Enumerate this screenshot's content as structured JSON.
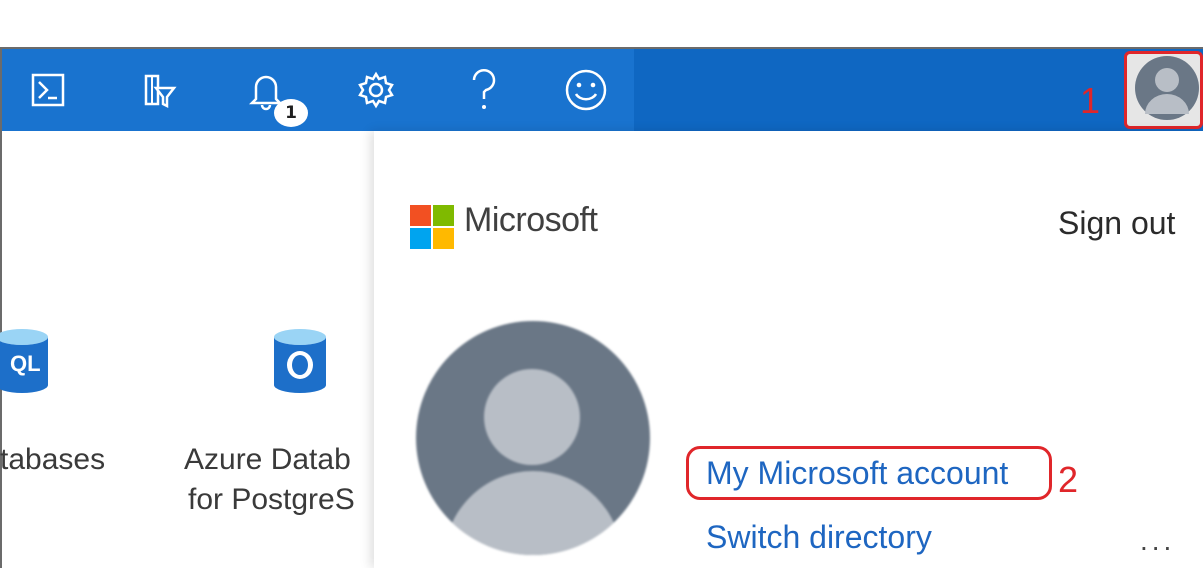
{
  "topbar": {
    "icons": [
      {
        "name": "cloud-shell-icon"
      },
      {
        "name": "directory-filter-icon"
      },
      {
        "name": "notifications-icon"
      },
      {
        "name": "settings-icon"
      },
      {
        "name": "help-icon"
      },
      {
        "name": "feedback-icon"
      }
    ],
    "notification_count": "1",
    "colors": {
      "bar": "#1973cf",
      "bar_right": "#0f67c2",
      "annotation": "#e0262a"
    }
  },
  "annotations": {
    "step1": "1",
    "step2": "2"
  },
  "left": {
    "tiles": [
      {
        "label_lines": [
          "tabases"
        ],
        "icon": "sql-database-icon"
      },
      {
        "label_lines": [
          "Azure Datab",
          "for PostgreS"
        ],
        "icon": "postgresql-database-icon"
      }
    ]
  },
  "account": {
    "brand": "Microsoft",
    "sign_out": "Sign out",
    "my_account_link": "My Microsoft account",
    "switch_directory_link": "Switch directory",
    "more": "..."
  }
}
